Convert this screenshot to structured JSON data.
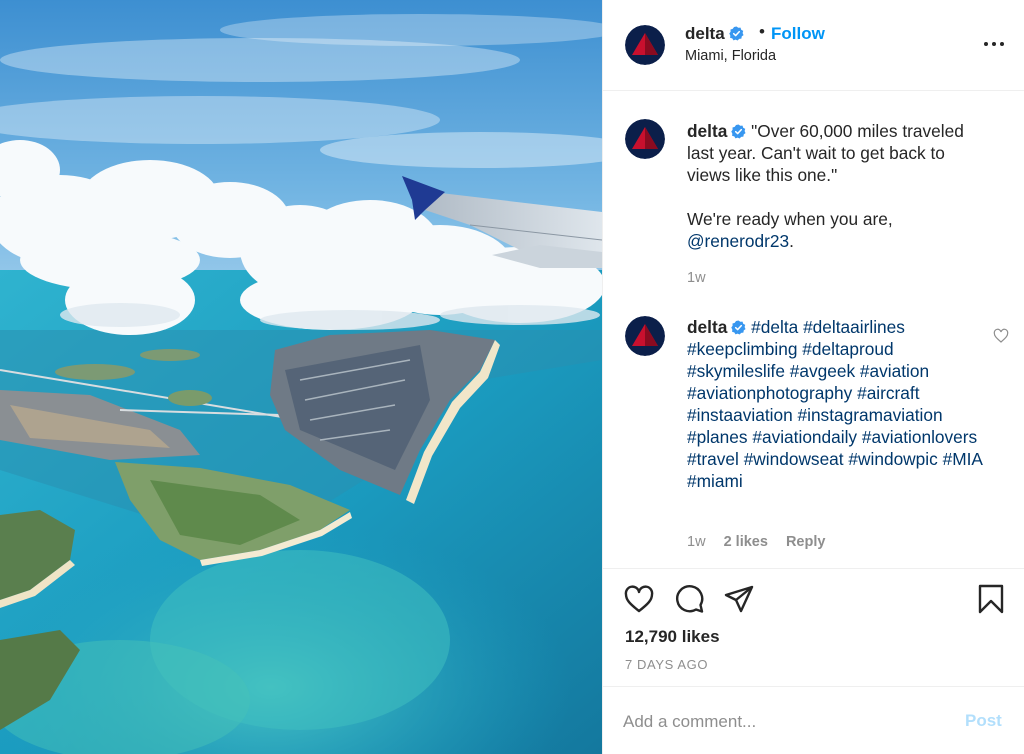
{
  "photo": {
    "alt_subject": "aerial-view-miami-beach",
    "colors": {
      "sky": "#4a9fd8",
      "cloud": "#f4f8fb",
      "ocean": "#1aa6c8",
      "land": "#6e8f63",
      "wing": "#c9d3dc",
      "winglet": "#1f3a93"
    }
  },
  "header": {
    "username": "delta",
    "separator": "•",
    "follow_label": "Follow",
    "location": "Miami, Florida"
  },
  "brand": {
    "delta_red": "#c8102e",
    "delta_dark_red": "#8a0b20",
    "verified_blue": "#3897f0",
    "link_blue": "#00376b",
    "follow_blue": "#0095f6"
  },
  "caption": {
    "username": "delta",
    "text_line1": "\"Over 60,000 miles traveled last year. Can't wait to get back to views like this one.\"",
    "text_line2": "We're ready when you are,",
    "mention": "@renerodr23",
    "mention_suffix": ".",
    "time": "1w"
  },
  "comment": {
    "username": "delta",
    "hashtags": [
      "#delta",
      "#deltaairlines",
      "#keepclimbing",
      "#deltaproud",
      "#skymileslife",
      "#avgeek",
      "#aviation",
      "#aviationphotography",
      "#aircraft",
      "#instaaviation",
      "#instagramaviation",
      "#planes",
      "#aviationdaily",
      "#aviationlovers",
      "#travel",
      "#windowseat",
      "#windowpic",
      "#MIA",
      "#miami"
    ],
    "time": "1w",
    "likes": "2 likes",
    "reply_label": "Reply"
  },
  "actions": {
    "likes": "12,790 likes",
    "date": "7 DAYS AGO"
  },
  "comment_box": {
    "placeholder": "Add a comment...",
    "post_label": "Post"
  }
}
